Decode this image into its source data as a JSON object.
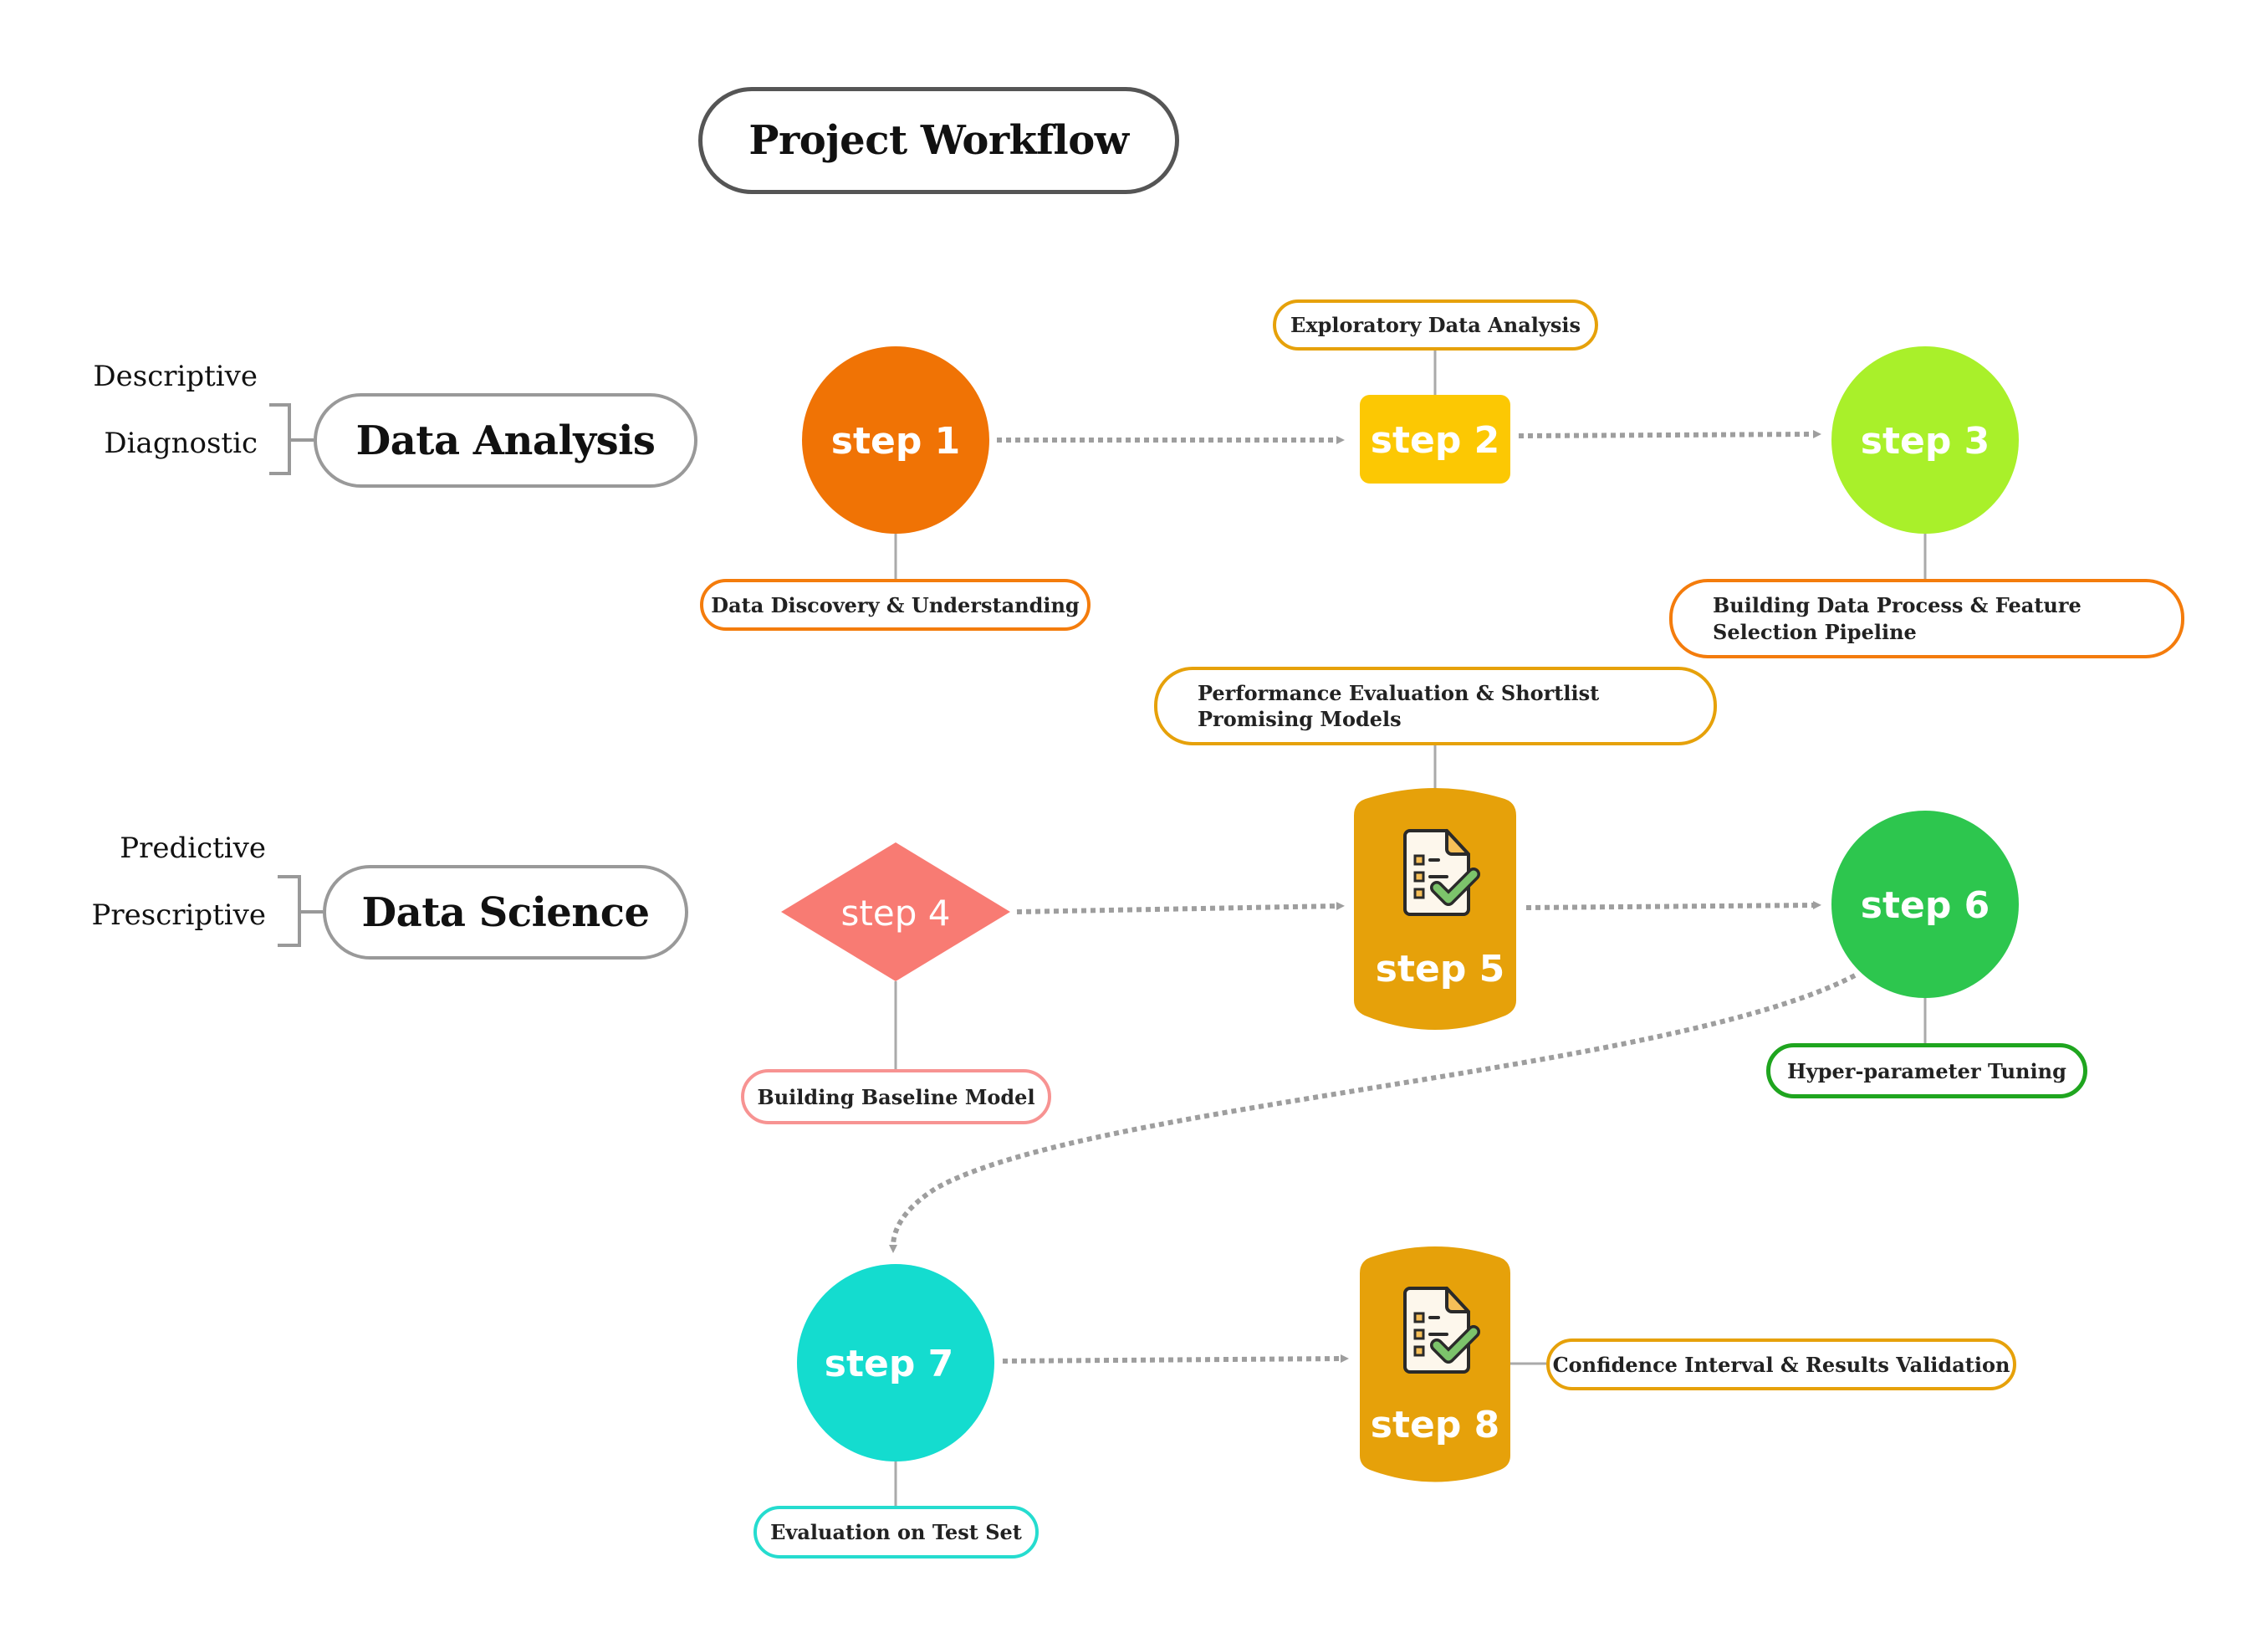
{
  "title": "Project Workflow",
  "colors": {
    "connector": "#9e9e9e",
    "arrow_dots": "#9e9e9e",
    "step1": "#f07305",
    "step2": "#fcc803",
    "step3": "#a9f02a",
    "step4": "#f87b73",
    "step5": "#e6a10a",
    "step6": "#2dc64e",
    "step7": "#14dccf",
    "step8": "#e6a10a"
  },
  "sections": [
    {
      "name": "Data Analysis",
      "tags": [
        "Descriptive",
        "Diagnostic"
      ]
    },
    {
      "name": "Data Science",
      "tags": [
        "Predictive",
        "Prescriptive"
      ]
    }
  ],
  "steps": [
    {
      "id": 1,
      "label": "step 1",
      "shape": "circle",
      "note": "Data Discovery & Understanding",
      "note_color": "#f47c0c"
    },
    {
      "id": 2,
      "label": "step 2",
      "shape": "rounded-rect",
      "note": "Exploratory Data Analysis",
      "note_color": "#e6a10a"
    },
    {
      "id": 3,
      "label": "step 3",
      "shape": "circle",
      "note": "Building Data Process & Feature Selection Pipeline",
      "note_color": "#f47c0c"
    },
    {
      "id": 4,
      "label": "step 4",
      "shape": "diamond",
      "note": "Building Baseline Model",
      "note_color": "#f79392"
    },
    {
      "id": 5,
      "label": "step 5",
      "shape": "document-card",
      "icon": "checklist-document-icon",
      "note": "Performance Evaluation & Shortlist Promising Models",
      "note_color": "#e6a10a"
    },
    {
      "id": 6,
      "label": "step 6",
      "shape": "circle",
      "note": "Hyper-parameter Tuning",
      "note_color": "#1fa51f"
    },
    {
      "id": 7,
      "label": "step 7",
      "shape": "circle",
      "note": "Evaluation on Test Set",
      "note_color": "#25dccf"
    },
    {
      "id": 8,
      "label": "step 8",
      "shape": "document-card",
      "icon": "checklist-document-icon",
      "note": "Confidence Interval & Results Validation",
      "note_color": "#e6a10a"
    }
  ],
  "flow": [
    {
      "from": 1,
      "to": 2
    },
    {
      "from": 2,
      "to": 3
    },
    {
      "from": 4,
      "to": 5
    },
    {
      "from": 5,
      "to": 6
    },
    {
      "from": 6,
      "to": 7
    },
    {
      "from": 7,
      "to": 8
    }
  ]
}
